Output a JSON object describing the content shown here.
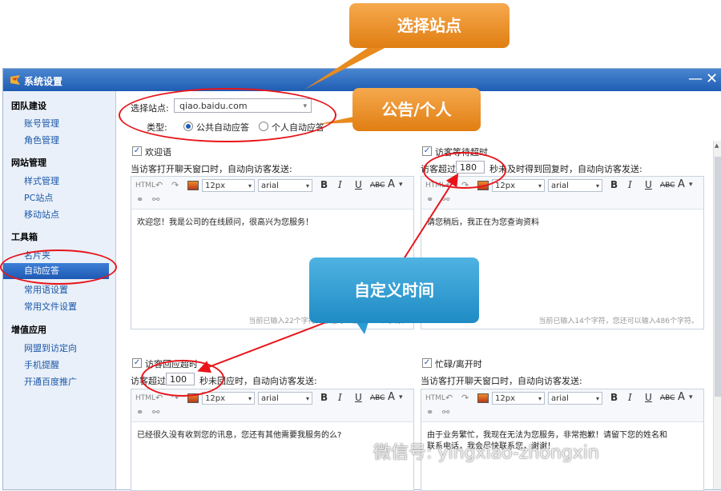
{
  "callouts": {
    "select_site": "选择站点",
    "notice_personal": "公告/个人",
    "custom_time": "自定义时间"
  },
  "window": {
    "title": "系统设置",
    "minimize": "—",
    "close": "✕"
  },
  "sidebar": {
    "groups": [
      {
        "title": "团队建设",
        "items": [
          "账号管理",
          "角色管理"
        ]
      },
      {
        "title": "网站管理",
        "items": [
          "样式管理",
          "PC站点",
          "移动站点"
        ]
      },
      {
        "title": "工具箱",
        "items": [
          "名片夹",
          "自动应答",
          "常用语设置",
          "常用文件设置"
        ]
      },
      {
        "title": "增值应用",
        "items": [
          "网盟到访定向",
          "手机提醒",
          "开通百度推广"
        ]
      }
    ],
    "active": "自动应答"
  },
  "settings": {
    "site_label": "选择站点:",
    "site_value": "qiao.baidu.com",
    "type_label": "类型:",
    "type_options": [
      "公共自动应答",
      "个人自动应答"
    ],
    "type_selected": "公共自动应答"
  },
  "toolbar": {
    "html": "HTML",
    "font_size": "12px",
    "font_family": "arial",
    "bold": "B",
    "italic": "I",
    "underline": "U",
    "strike": "ABC",
    "color": "A",
    "link": "⚭",
    "unlink": "⚯"
  },
  "panels": {
    "welcome": {
      "title": "欢迎语",
      "desc": "当访客打开聊天窗口时，自动向访客发送:",
      "content": "欢迎您！我是公司的在线顾问，很高兴为您服务！",
      "count": "当前已输入22个字符，您还可以输入478个字符。"
    },
    "visitor_wait": {
      "title": "访客等待超时",
      "desc_pre": "访客超过",
      "seconds": "180",
      "desc_post": "秒未及时得到回复时，自动向访客发送:",
      "content": "请您稍后，我正在为您查询资料",
      "count": "当前已输入14个字符，您还可以输入486个字符。"
    },
    "visitor_reply": {
      "title": "访客回应超时",
      "desc_pre": "访客超过",
      "seconds": "100",
      "desc_post": "秒未回应时，自动向访客发送:",
      "content": "已经很久没有收到您的讯息，您还有其他需要我服务的么?"
    },
    "busy_away": {
      "title": "忙碌/离开时",
      "desc": "当访客打开聊天窗口时，自动向访客发送:",
      "content_line1": "由于业务繁忙，我现在无法为您服务，非常抱歉！请留下您的姓名和",
      "content_line2": "联系电话，我会尽快联系您，谢谢！"
    }
  },
  "watermark": "微信号: yingxiao-zhongxin",
  "colors": {
    "accent": "#1f5db4",
    "callout_orange": "#e98a1e",
    "callout_blue": "#2a9bd3",
    "annotation_red": "#e8141a"
  }
}
